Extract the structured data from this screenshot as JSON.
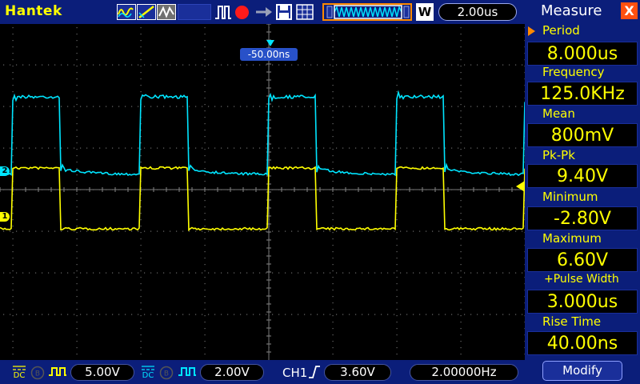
{
  "header": {
    "brand": "Hantek",
    "timebase": "2.00us",
    "w_label": "W",
    "trigger_position": "-50.00ns"
  },
  "measure_panel": {
    "title": "Measure",
    "close_label": "X",
    "items": [
      {
        "label": "Period",
        "value": "8.000us"
      },
      {
        "label": "Frequency",
        "value": "125.0KHz"
      },
      {
        "label": "Mean",
        "value": "800mV"
      },
      {
        "label": "Pk-Pk",
        "value": "9.40V"
      },
      {
        "label": "Minimum",
        "value": "-2.80V"
      },
      {
        "label": "Maximum",
        "value": "6.60V"
      },
      {
        "label": "+Pulse Width",
        "value": "3.000us"
      },
      {
        "label": "Rise Time",
        "value": "40.00ns"
      }
    ],
    "modify_label": "Modify"
  },
  "status_bar": {
    "ch1_coupling": "DC",
    "ch1_scale": "5.00V",
    "ch2_coupling": "DC",
    "ch2_scale": "2.00V",
    "trigger_source": "CH1",
    "trigger_level": "3.60V",
    "frequency": "2.00000Hz"
  },
  "channels": [
    {
      "id": "1",
      "color": "#ffff00"
    },
    {
      "id": "2",
      "color": "#00e5ff"
    }
  ],
  "colors": {
    "panel_bg": "#0b1e7a",
    "accent": "#ff8a00",
    "ch1": "#ffff00",
    "ch2": "#00e5ff",
    "trigger_marker": "#2851c8"
  },
  "icons": [
    "waveform-icon",
    "slope-icon",
    "persistence-icon",
    "trigger-mode-icon",
    "record-icon",
    "arrow-icon",
    "save-icon",
    "grid-icon",
    "memory-depth-icon",
    "trigger-slope-icon"
  ]
}
